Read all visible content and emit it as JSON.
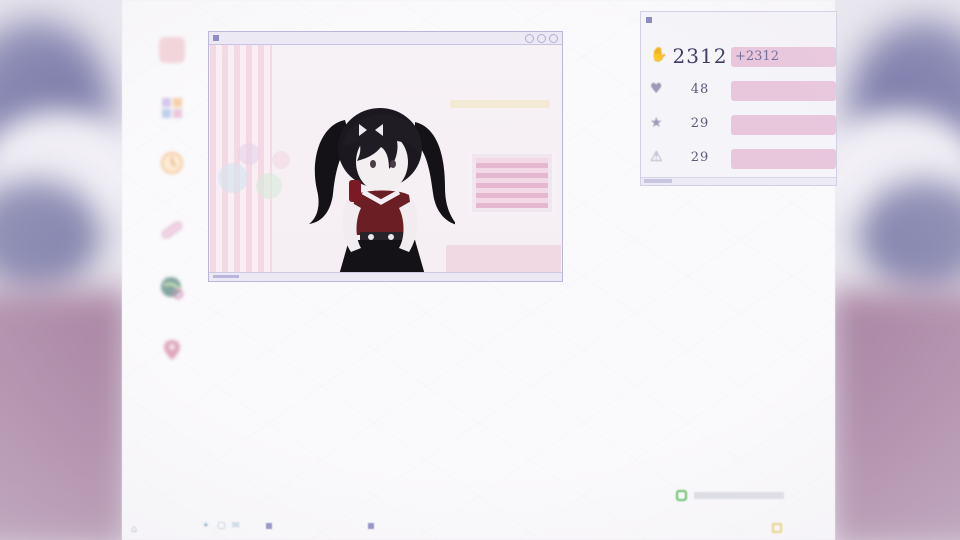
{
  "stream_window": {
    "title": "",
    "accent": "#b9b6dc"
  },
  "apps": [
    {
      "icon": "blank-app-icon",
      "color": "#f1c8cf"
    },
    {
      "icon": "puzzle-app-icon",
      "color": "#c7b7e6"
    },
    {
      "icon": "clock-app-icon",
      "color": "#f3c38e"
    },
    {
      "icon": "bandage-app-icon",
      "color": "#e7c4db"
    },
    {
      "icon": "globe-app-icon",
      "color": "#6f9b8a"
    },
    {
      "icon": "map-pin-app-icon",
      "color": "#d58ea6"
    }
  ],
  "stats": {
    "title": "",
    "rows": [
      {
        "icon": "hand-icon",
        "value": "2312",
        "delta": "+2312"
      },
      {
        "icon": "heart-icon",
        "value": "48",
        "label": ""
      },
      {
        "icon": "star-icon",
        "value": "29",
        "label": ""
      },
      {
        "icon": "alert-icon",
        "value": "29",
        "label": ""
      }
    ]
  },
  "taskbar": {
    "item1": "",
    "item2": ""
  },
  "colors": {
    "panel_bg": "#f5f4f8",
    "pill": "#e8c6dc",
    "number": "#3f3d66",
    "notification_green": "#59c05f"
  }
}
